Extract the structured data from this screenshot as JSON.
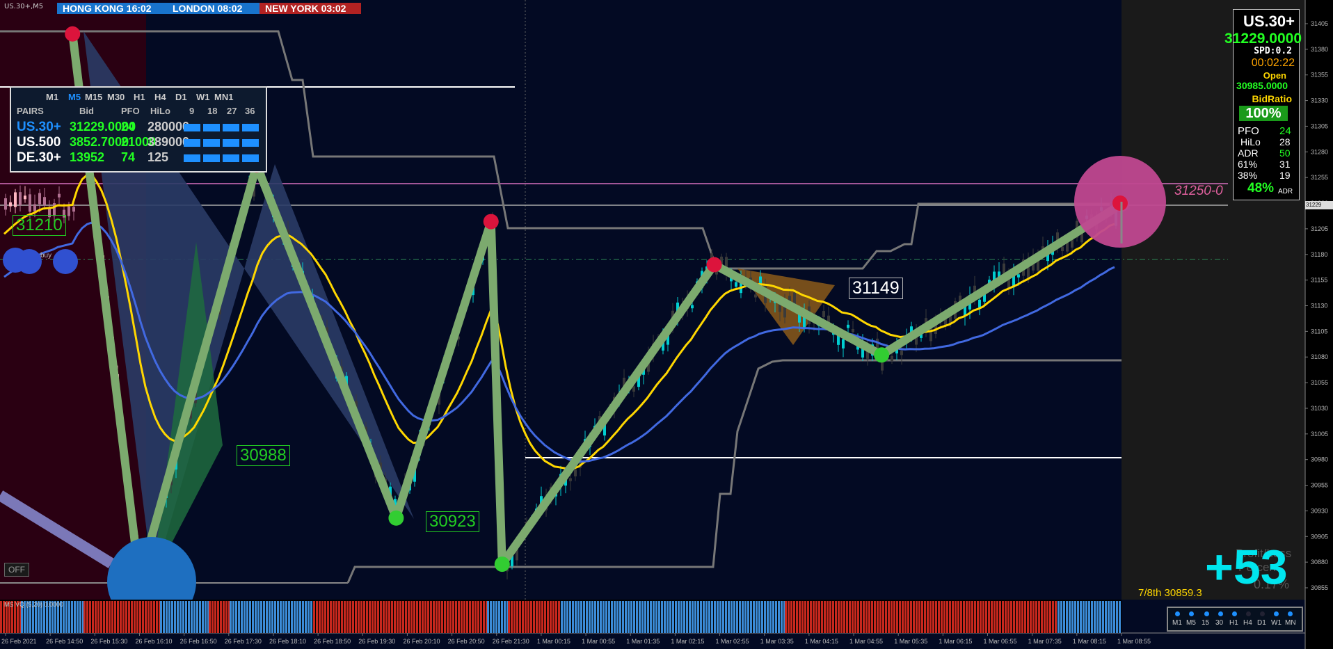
{
  "symbol_tag": "US.30+,M5",
  "sessions": [
    {
      "label": "HONG KONG  16:02",
      "color": "#1874cd"
    },
    {
      "label": "LONDON  08:02",
      "color": "#1874cd"
    },
    {
      "label": "NEW YORK  03:02",
      "color": "#b22222"
    }
  ],
  "panel": {
    "timeframes": [
      "M1",
      "M5",
      "M15",
      "M30",
      "H1",
      "H4",
      "D1",
      "W1",
      "MN1"
    ],
    "active_timeframe": "M5",
    "headers": [
      "PAIRS",
      "Bid",
      "PFO",
      "HiLo",
      "9",
      "18",
      "27",
      "36"
    ],
    "rows": [
      {
        "pair": "US.30+",
        "bid": "31229.0000",
        "pfo": "24",
        "hilo": "280000",
        "color": "#1e90ff"
      },
      {
        "pair": "US.500",
        "bid": "3852.7000",
        "pfo": "21000",
        "hilo": "389000",
        "color": "#ffffff"
      },
      {
        "pair": "DE.30+",
        "bid": "13952",
        "pfo": "74",
        "hilo": "125",
        "color": "#ffffff"
      }
    ]
  },
  "infobox": {
    "symbol": "US.30+",
    "price": "31229.0000",
    "spread": "SPD:0.2",
    "timer": "00:02:22",
    "open_label": "Open",
    "open_value": "30985.0000",
    "bidratio_label": "BidRatio",
    "bidratio_value": "100%",
    "stats": [
      {
        "name": "PFO",
        "value": "24"
      },
      {
        "name": "HiLo",
        "value": "28"
      },
      {
        "name": "ADR",
        "value": "50"
      },
      {
        "name": "61%",
        "value": "31"
      },
      {
        "name": "38%",
        "value": "19"
      }
    ],
    "adr_pct": "48%",
    "adr_tag": "ADR"
  },
  "labels": {
    "l31210": "31210",
    "l30988": "30988",
    "l30923": "30923",
    "l31149": "31149",
    "l31250": "31250-0",
    "buy": "buy",
    "off": "OFF",
    "pnl": "+53",
    "pnl_title": "Profit/Loss",
    "pnl_sub": "Percent",
    "pnl_pct": "0.17%",
    "eighth": "7/8th  30859.3",
    "vq": "MS VQ (5,20) 0.0000",
    "price_marker": "31229"
  },
  "tf_buttons": [
    "M1",
    "M5",
    "15",
    "30",
    "H1",
    "H4",
    "D1",
    "W1",
    "MN"
  ],
  "colors": {
    "background": "#030a23",
    "bull": "#00ced1",
    "bear": "#3a3a3a",
    "ma_yellow": "#ffd700",
    "ma_blue": "#4169e1",
    "zigzag": "#7caa6e",
    "grid": "#4a4a4a"
  },
  "chart_data": {
    "type": "candlestick",
    "symbol": "US.30+",
    "timeframe": "M5",
    "y_ticks": [
      31405,
      31380,
      31355,
      31330,
      31305,
      31280,
      31255,
      31230,
      31205,
      31180,
      31155,
      31130,
      31105,
      31080,
      31055,
      31030,
      31005,
      30980,
      30955,
      30930,
      30905,
      30880,
      30855
    ],
    "x_ticks": [
      "26 Feb 2021",
      "26 Feb 14:50",
      "26 Feb 15:30",
      "26 Feb 16:10",
      "26 Feb 16:50",
      "26 Feb 17:30",
      "26 Feb 18:10",
      "26 Feb 18:50",
      "26 Feb 19:30",
      "26 Feb 20:10",
      "26 Feb 20:50",
      "26 Feb 21:30",
      "1 Mar 00:15",
      "1 Mar 00:55",
      "1 Mar 01:35",
      "1 Mar 02:15",
      "1 Mar 02:55",
      "1 Mar 03:35",
      "1 Mar 04:15",
      "1 Mar 04:55",
      "1 Mar 05:35",
      "1 Mar 06:15",
      "1 Mar 06:55",
      "1 Mar 07:35",
      "1 Mar 08:15",
      "1 Mar 08:55"
    ],
    "zigzag": [
      {
        "t": "26 Feb 15:10",
        "price": 31395
      },
      {
        "t": "26 Feb 16:10",
        "price": 30863
      },
      {
        "t": "26 Feb 17:55",
        "price": 31267
      },
      {
        "t": "26 Feb 20:00",
        "price": 30923
      },
      {
        "t": "26 Feb 21:25",
        "price": 31212
      },
      {
        "t": "26 Feb 21:35",
        "price": 30878
      },
      {
        "t": "1 Mar 02:50",
        "price": 31170
      },
      {
        "t": "1 Mar 05:20",
        "price": 31082
      },
      {
        "t": "1 Mar 08:55",
        "price": 31229
      }
    ],
    "annotations": [
      {
        "text": "31210",
        "price": 31210
      },
      {
        "text": "30988",
        "price": 30988
      },
      {
        "text": "30923",
        "price": 30923
      },
      {
        "text": "31149",
        "price": 31149
      }
    ],
    "last_price": 31229
  }
}
